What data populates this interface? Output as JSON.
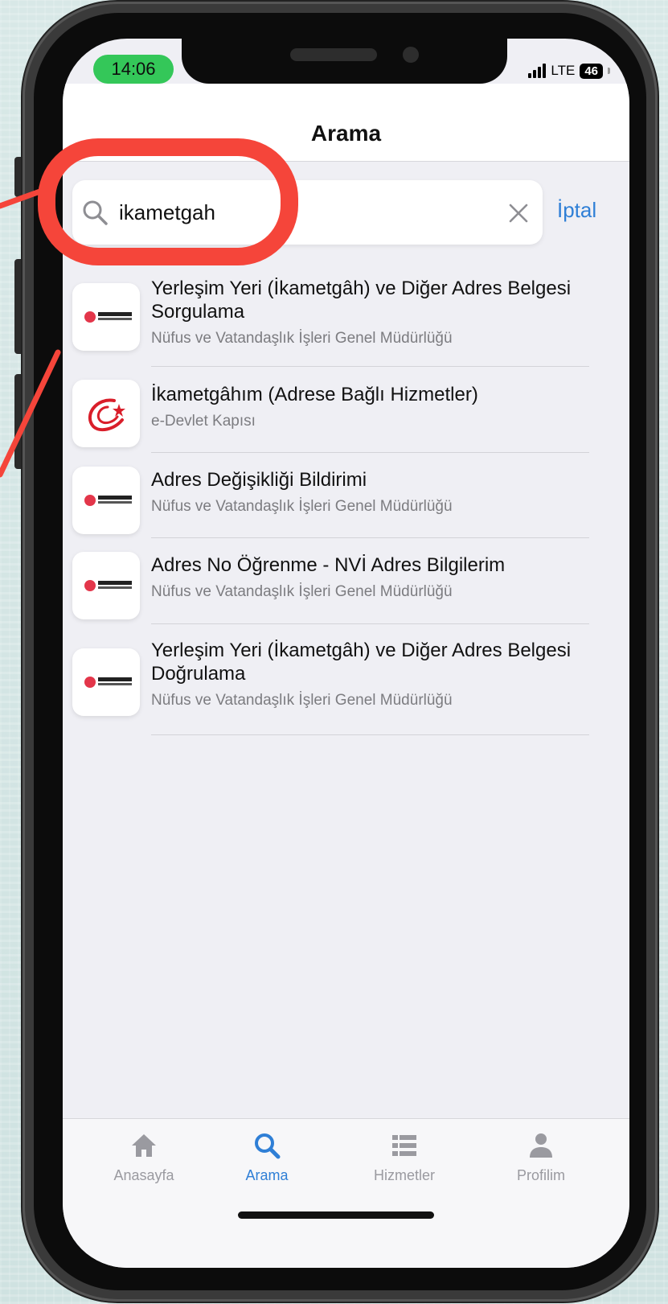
{
  "status_bar": {
    "time": "14:06",
    "network": "LTE",
    "battery": "46"
  },
  "nav": {
    "title": "Arama"
  },
  "search": {
    "value": "ikametgah",
    "cancel_label": "İptal"
  },
  "results": [
    {
      "title": "Yerleşim Yeri (İkametgâh) ve Diğer Adres Belgesi Sorgulama",
      "subtitle": "Nüfus ve Vatandaşlık İşleri Genel Müdürlüğü",
      "logo": "nufus-logo-icon"
    },
    {
      "title": "İkametgâhım (Adrese Bağlı Hizmetler)",
      "subtitle": "e-Devlet Kapısı",
      "logo": "edevlet-logo-icon"
    },
    {
      "title": "Adres Değişikliği Bildirimi",
      "subtitle": "Nüfus ve Vatandaşlık İşleri Genel Müdürlüğü",
      "logo": "nufus-logo-icon"
    },
    {
      "title": "Adres No Öğrenme - NVİ Adres Bilgilerim",
      "subtitle": "Nüfus ve Vatandaşlık İşleri Genel Müdürlüğü",
      "logo": "nufus-logo-icon"
    },
    {
      "title": "Yerleşim Yeri (İkametgâh) ve Diğer Adres Belgesi Doğrulama",
      "subtitle": "Nüfus ve Vatandaşlık İşleri Genel Müdürlüğü",
      "logo": "nufus-logo-icon"
    }
  ],
  "tabs": [
    {
      "label": "Anasayfa",
      "icon": "home-icon",
      "active": false
    },
    {
      "label": "Arama",
      "icon": "search-icon",
      "active": true
    },
    {
      "label": "Hizmetler",
      "icon": "list-icon",
      "active": false
    },
    {
      "label": "Profilim",
      "icon": "person-icon",
      "active": false
    }
  ],
  "colors": {
    "accent": "#2f7fd6",
    "highlight": "#f5453a",
    "time_pill": "#34c759"
  }
}
